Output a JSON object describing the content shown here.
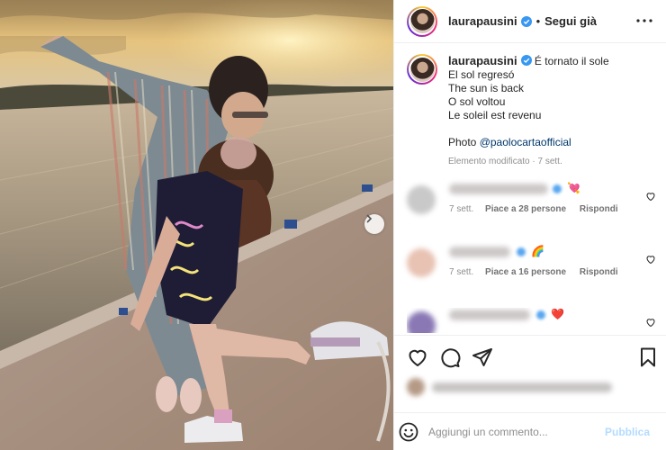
{
  "post": {
    "username": "laurapausini",
    "header_separator": "•",
    "follow_state": "Segui già",
    "caption_username": "laurapausini",
    "caption_lines": [
      "É tornato il sole",
      "El sol regresó",
      "The sun is back",
      "O sol voltou",
      "Le soleil est revenu"
    ],
    "photo_credit_prefix": "Photo ",
    "photo_credit_mention": "@paolocartaofficial",
    "edited_note": "Elemento modificato · 7 sett."
  },
  "comments": [
    {
      "time": "7 sett.",
      "likes": "Piace a 28 persone",
      "reply": "Rispondi",
      "emoji": "💘"
    },
    {
      "time": "7 sett.",
      "likes": "Piace a 16 persone",
      "reply": "Rispondi",
      "emoji": "🌈"
    },
    {
      "time": "",
      "likes": "",
      "reply": "",
      "emoji": "❤️"
    }
  ],
  "composer": {
    "placeholder": "Aggiungi un commento...",
    "publish_label": "Pubblica"
  },
  "icons": {
    "more": "more-horizontal-icon",
    "like": "heart-outline-icon",
    "comment": "speech-bubble-icon",
    "share": "paper-plane-icon",
    "save": "bookmark-icon",
    "emoji": "smiley-icon",
    "next": "chevron-right-icon",
    "verified": "verified-badge-icon"
  },
  "colors": {
    "verified": "#3897f0",
    "mention": "#00376b",
    "publish_disabled": "#b3dbff",
    "meta_gray": "#8e8e8e"
  }
}
